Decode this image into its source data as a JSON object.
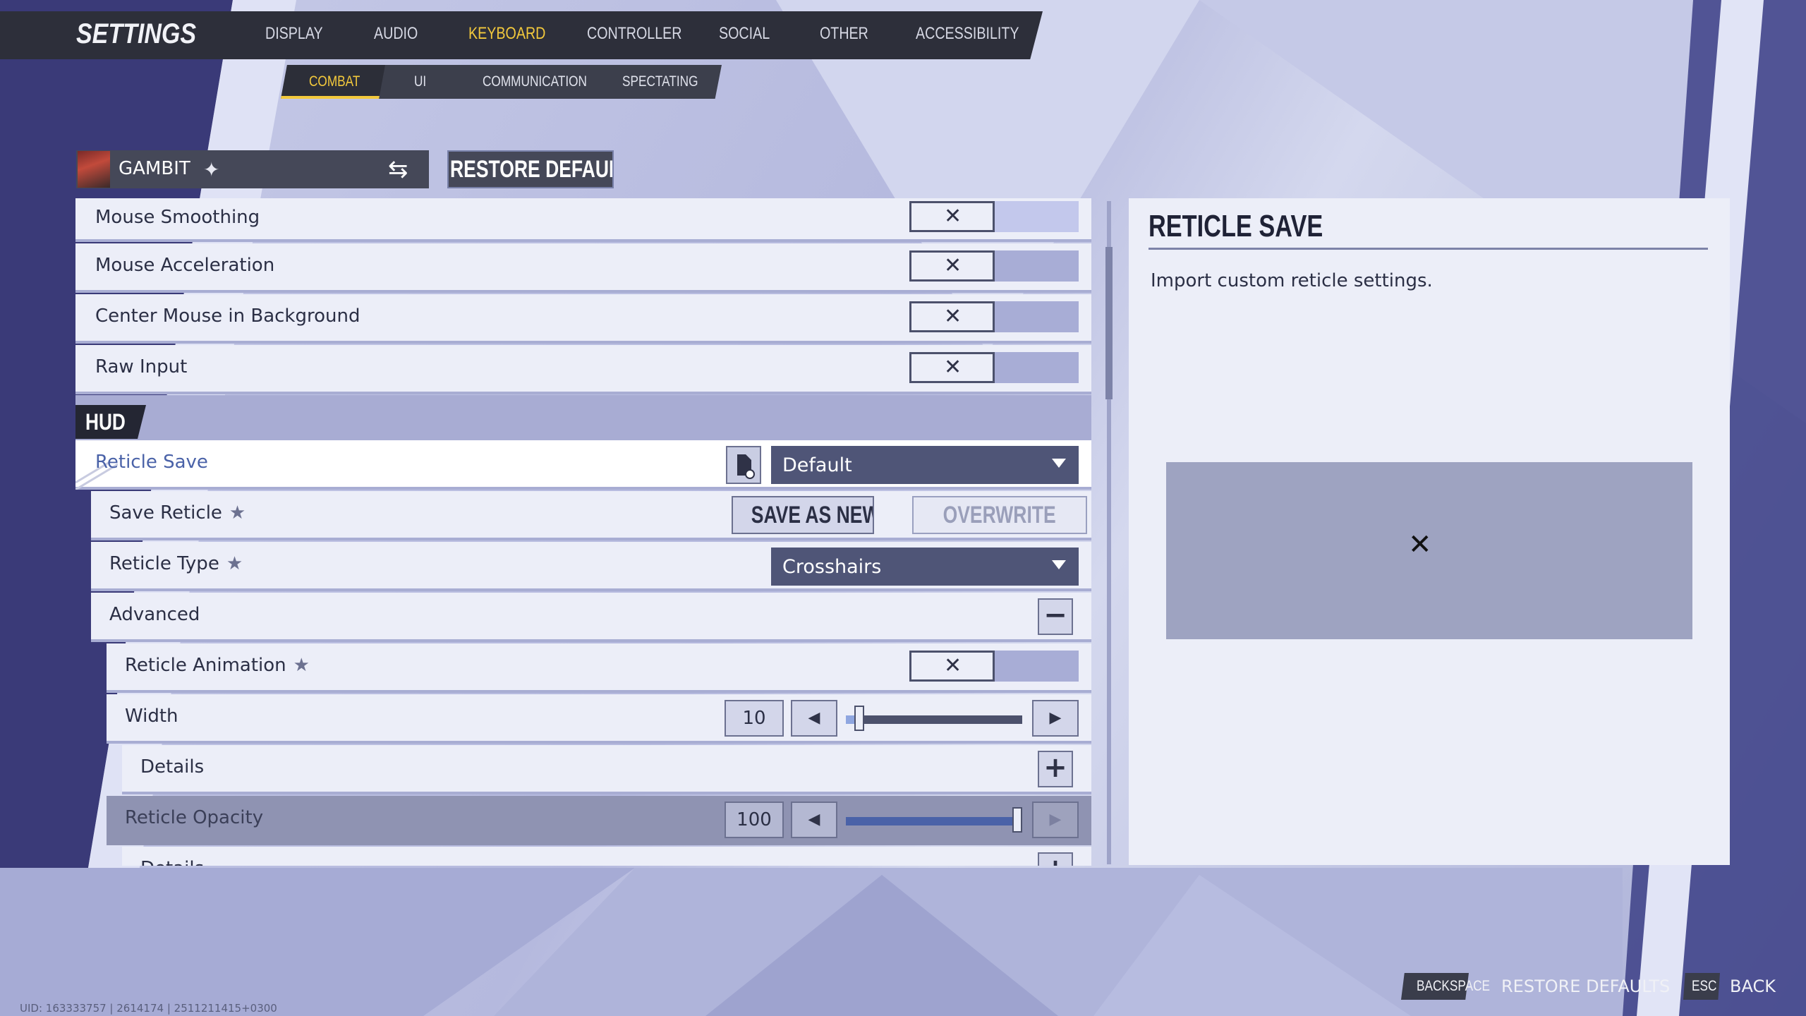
{
  "header": {
    "title": "SETTINGS",
    "tabs": [
      {
        "label": "DISPLAY",
        "active": false
      },
      {
        "label": "AUDIO",
        "active": false
      },
      {
        "label": "KEYBOARD",
        "active": true
      },
      {
        "label": "CONTROLLER",
        "active": false
      },
      {
        "label": "SOCIAL",
        "active": false
      },
      {
        "label": "OTHER",
        "active": false
      },
      {
        "label": "ACCESSIBILITY",
        "active": false
      }
    ],
    "subtabs": [
      {
        "label": "COMBAT",
        "active": true
      },
      {
        "label": "UI",
        "active": false
      },
      {
        "label": "COMMUNICATION",
        "active": false
      },
      {
        "label": "SPECTATING",
        "active": false
      }
    ]
  },
  "hero": {
    "name": "GAMBIT",
    "restore_label": "RESTORE DEFAULTS"
  },
  "settings": {
    "mouse_smoothing": {
      "label": "Mouse Smoothing",
      "value": "off"
    },
    "mouse_acceleration": {
      "label": "Mouse Acceleration",
      "value": "off"
    },
    "center_mouse": {
      "label": "Center Mouse in Background",
      "value": "off"
    },
    "raw_input": {
      "label": "Raw Input",
      "value": "off"
    },
    "hud_section": "HUD",
    "reticle_save": {
      "label": "Reticle Save",
      "value": "Default"
    },
    "save_reticle": {
      "label": "Save Reticle",
      "save_as_new": "SAVE AS NEW",
      "overwrite": "OVERWRITE"
    },
    "reticle_type": {
      "label": "Reticle Type",
      "value": "Crosshairs"
    },
    "advanced": {
      "label": "Advanced",
      "expanded": true
    },
    "reticle_animation": {
      "label": "Reticle Animation",
      "value": "off"
    },
    "width": {
      "label": "Width",
      "value": "10",
      "fraction": 0.05
    },
    "details_1": {
      "label": "Details",
      "expanded": false
    },
    "reticle_opacity": {
      "label": "Reticle Opacity",
      "value": "100",
      "fraction": 1.0
    },
    "details_2": {
      "label": "Details"
    }
  },
  "panel": {
    "title": "RETICLE SAVE",
    "description": "Import custom reticle settings."
  },
  "footer": {
    "restore_key": "BACKSPACE",
    "restore_action": "RESTORE DEFAULTS",
    "back_key": "ESC",
    "back_action": "BACK",
    "uid": "UID: 163333757 | 2614174 | 2511211415+0300"
  },
  "colors": {
    "accent": "#f3c93c",
    "dark_bar": "#2d2f3a",
    "row_bg": "#eceef8",
    "section_bg": "#a8acd3",
    "dropdown_bg": "#4f5577",
    "active_row_label": "#4a62a8"
  },
  "icons": {
    "toggle": "close-x-icon",
    "swap": "swap-arrows-icon",
    "hero_rank": "diamond-icon",
    "file": "file-import-icon",
    "star": "star-icon",
    "caret": "caret-down-icon"
  }
}
